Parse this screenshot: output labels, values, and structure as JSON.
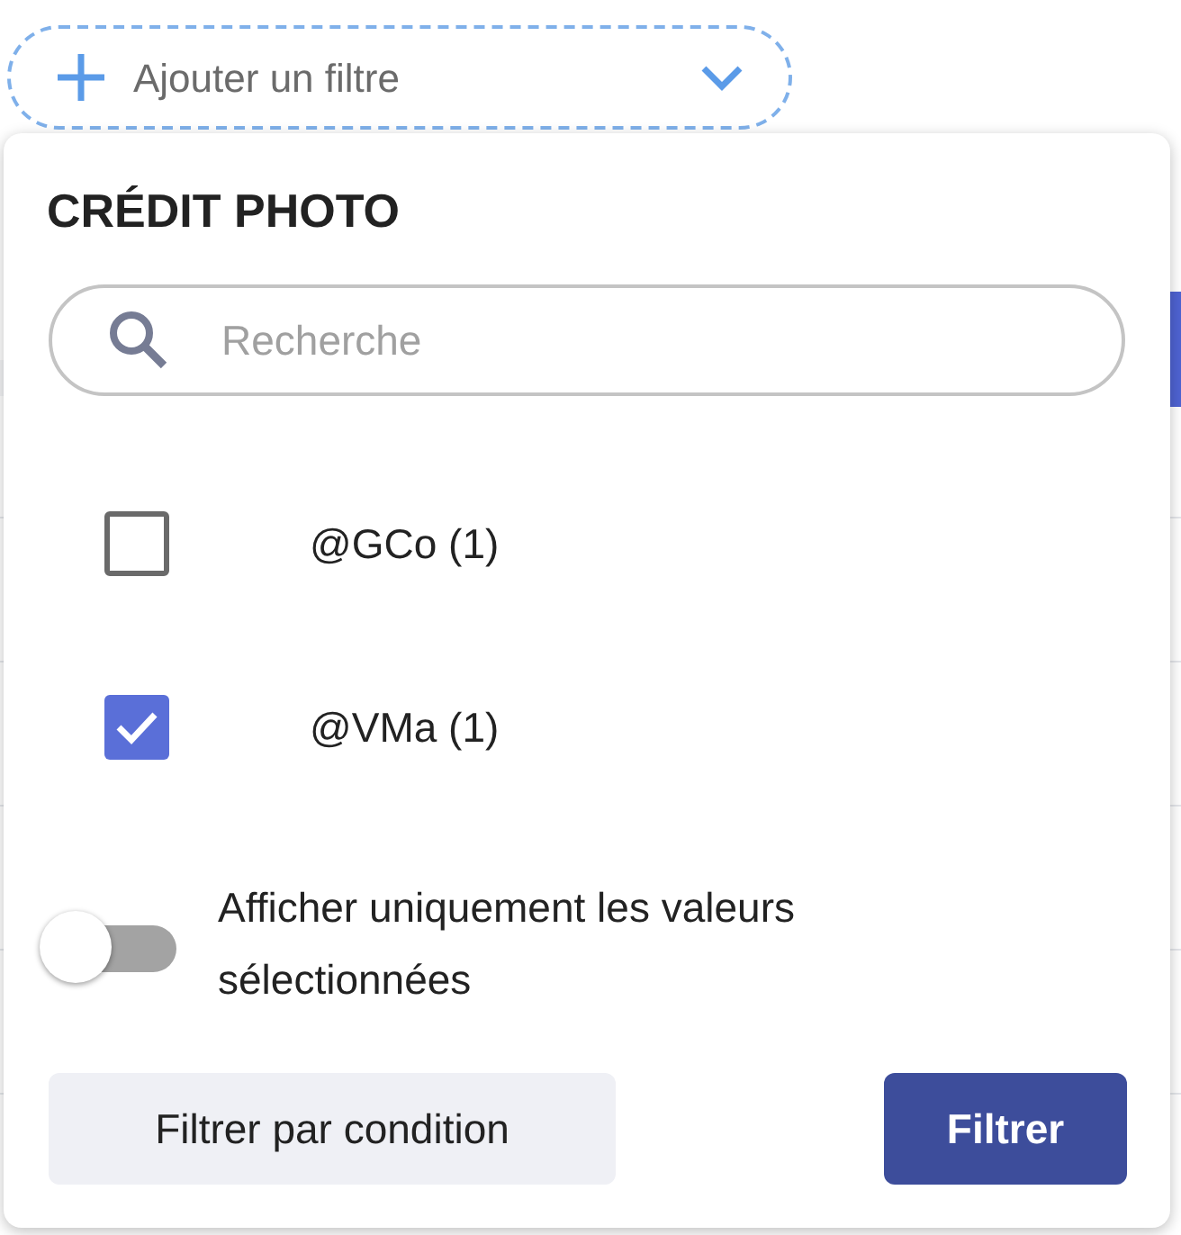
{
  "filter_button": {
    "label": "Ajouter un filtre"
  },
  "popover": {
    "title": "CRÉDIT PHOTO",
    "search": {
      "placeholder": "Recherche"
    },
    "options": [
      {
        "label": "@GCo (1)",
        "checked": false
      },
      {
        "label": "@VMa (1)",
        "checked": true
      }
    ],
    "toggle": {
      "label": "Afficher uniquement les valeurs sélectionnées",
      "on": false
    },
    "buttons": [
      {
        "label": "Filtrer par condition",
        "kind": "secondary"
      },
      {
        "label": "Filtrer",
        "kind": "primary"
      }
    ]
  }
}
